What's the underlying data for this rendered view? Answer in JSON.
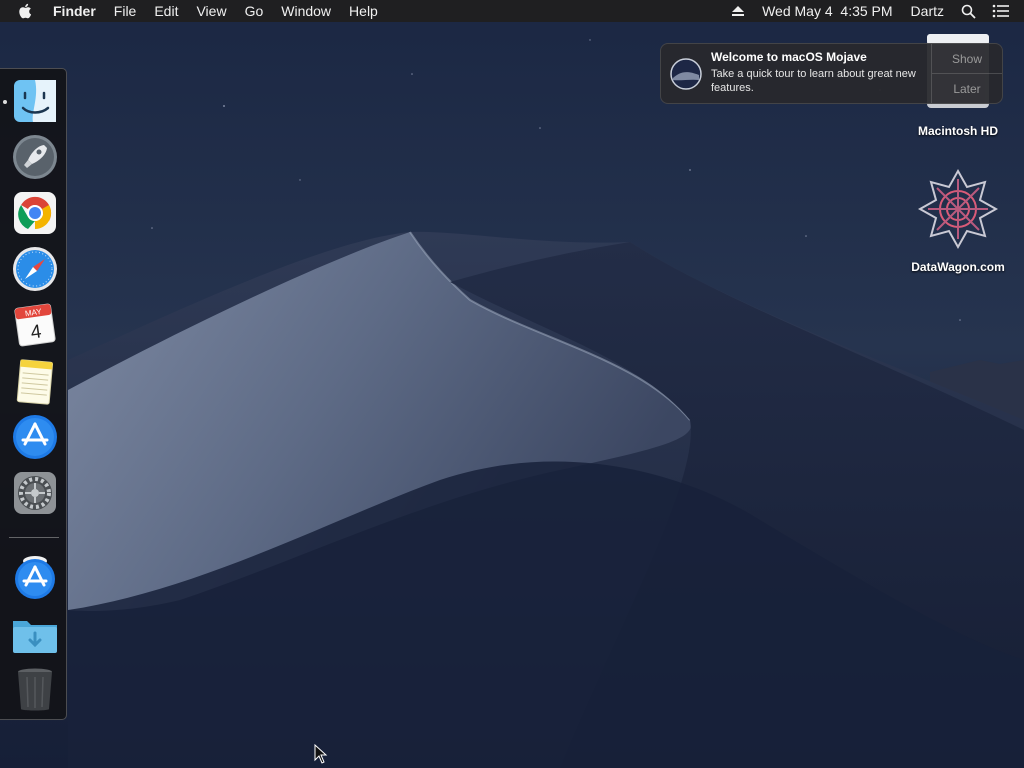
{
  "menubar": {
    "apple_icon": "apple-icon",
    "app_name": "Finder",
    "menus": [
      "File",
      "Edit",
      "View",
      "Go",
      "Window"
    ],
    "help": "Help",
    "clock": "Wed May 4  4:35 PM",
    "user": "Dartz",
    "right_icons": [
      "eject-icon",
      "spotlight-search-icon",
      "notification-center-icon"
    ]
  },
  "notification": {
    "title": "Welcome to macOS Mojave",
    "body": "Take a quick tour to learn about great new features.",
    "show_label": "Show",
    "later_label": "Later"
  },
  "desktop_icons": [
    {
      "label": "Macintosh HD",
      "icon": "hard-drive-icon"
    },
    {
      "label": "DataWagon.com",
      "icon": "datawagon-logo-icon"
    }
  ],
  "dock": {
    "items": [
      {
        "name": "Finder",
        "icon": "finder-icon",
        "running": true
      },
      {
        "name": "Launchpad",
        "icon": "launchpad-icon"
      },
      {
        "name": "Google Chrome",
        "icon": "chrome-icon"
      },
      {
        "name": "Safari",
        "icon": "safari-icon"
      },
      {
        "name": "Calendar",
        "icon": "calendar-icon",
        "month": "MAY",
        "day": "4"
      },
      {
        "name": "Notes",
        "icon": "notes-icon"
      },
      {
        "name": "App Store",
        "icon": "app-store-icon"
      },
      {
        "name": "System Preferences",
        "icon": "system-preferences-icon"
      },
      {
        "name": "App Store (install)",
        "icon": "app-store-install-icon"
      },
      {
        "name": "Downloads",
        "icon": "downloads-folder-icon"
      },
      {
        "name": "Trash",
        "icon": "trash-icon"
      }
    ]
  },
  "colors": {
    "menubar_bg": "#1f1f21",
    "sky": "#1e2a48",
    "dune": "#5a6781"
  }
}
